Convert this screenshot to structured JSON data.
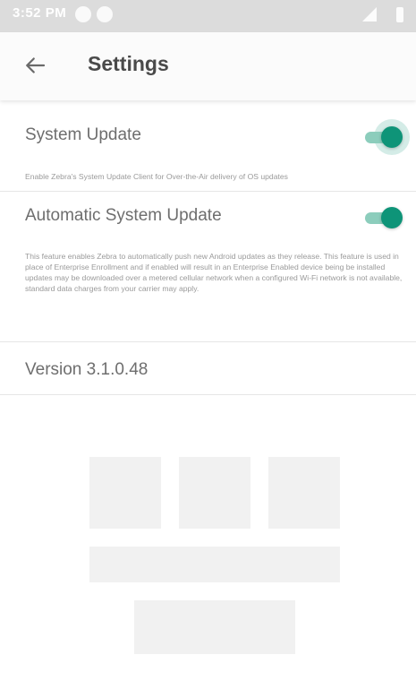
{
  "status_bar": {
    "time": "3:52 PM",
    "icons": [
      "notification-icon",
      "notification-icon",
      "signal-icon",
      "battery-icon"
    ]
  },
  "app_bar": {
    "back_icon": "back-arrow-icon",
    "title": "Settings"
  },
  "settings": [
    {
      "title": "System Update",
      "description": "Enable Zebra's System Update Client for Over-the-Air delivery of OS updates",
      "enabled": true,
      "focused": true
    },
    {
      "title": "Automatic System Update",
      "description": "This feature enables Zebra to automatically push new Android updates as they release. This feature is used in place of Enterprise Enrollment and if enabled will result in an Enterprise Enabled device being be installed updates may be downloaded over a metered cellular network when a configured Wi-Fi network is not available, standard data charges from your carrier may apply.",
      "enabled": true,
      "focused": false
    }
  ],
  "version": "Version 3.1.0.48",
  "colors": {
    "accent": "#0e9478",
    "track": "#8ccdbc",
    "status_bar": "#dcdcdc",
    "app_bar": "#fbfbfb"
  }
}
